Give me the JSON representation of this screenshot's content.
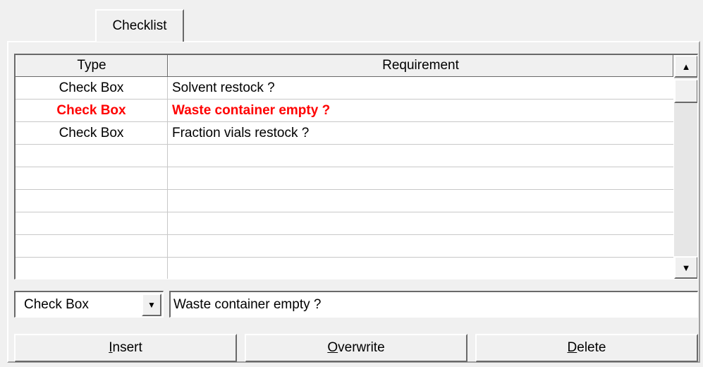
{
  "tabs": [
    {
      "label": "Checklist"
    }
  ],
  "grid": {
    "columns": {
      "type": "Type",
      "requirement": "Requirement"
    },
    "rows": [
      {
        "type": "Check Box",
        "requirement": "Solvent restock ?"
      },
      {
        "type": "Check Box",
        "requirement": "Waste container empty ?"
      },
      {
        "type": "Check Box",
        "requirement": "Fraction vials restock ?"
      },
      {
        "type": "",
        "requirement": ""
      },
      {
        "type": "",
        "requirement": ""
      },
      {
        "type": "",
        "requirement": ""
      },
      {
        "type": "",
        "requirement": ""
      },
      {
        "type": "",
        "requirement": ""
      },
      {
        "type": "",
        "requirement": ""
      }
    ],
    "selected_row": 1,
    "selected_color": "#ff0000"
  },
  "scrollbar": {
    "up_icon": "▲",
    "down_icon": "▼"
  },
  "editor": {
    "type_select": {
      "value": "Check Box",
      "icon": "▼"
    },
    "requirement_input": {
      "value": "Waste container empty ?"
    }
  },
  "buttons": {
    "insert": {
      "mnemonic": "I",
      "rest": "nsert"
    },
    "overwrite": {
      "mnemonic": "O",
      "rest": "verwrite"
    },
    "delete": {
      "mnemonic": "D",
      "rest": "elete"
    }
  }
}
